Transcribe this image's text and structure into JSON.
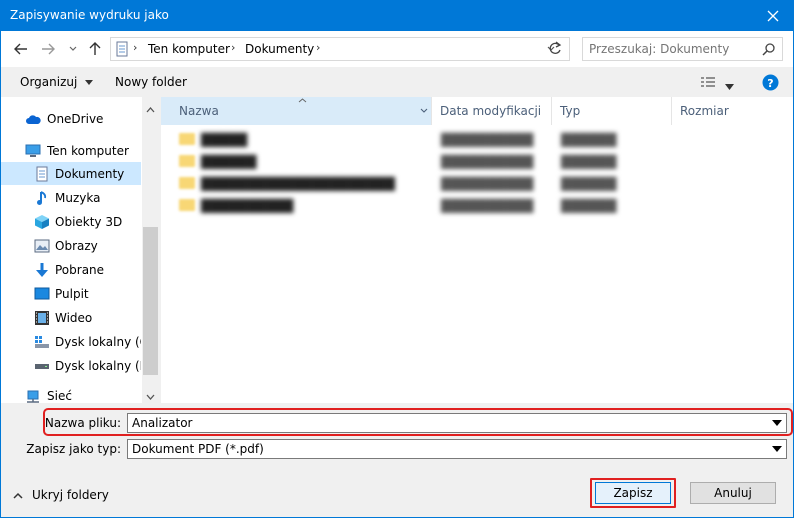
{
  "window": {
    "title": "Zapisywanie wydruku jako"
  },
  "address": {
    "crumbs": [
      "Ten komputer",
      "Dokumenty"
    ]
  },
  "search": {
    "placeholder": "Przeszukaj: Dokumenty"
  },
  "toolbar": {
    "organize_label": "Organizuj",
    "new_folder_label": "Nowy folder"
  },
  "sidebar": {
    "items": [
      {
        "label": "OneDrive",
        "icon": "cloud-icon"
      },
      {
        "label": "Ten komputer",
        "icon": "computer-icon"
      },
      {
        "label": "Dokumenty",
        "icon": "document-icon",
        "selected": true
      },
      {
        "label": "Muzyka",
        "icon": "music-note-icon"
      },
      {
        "label": "Obiekty 3D",
        "icon": "cube-3d-icon"
      },
      {
        "label": "Obrazy",
        "icon": "picture-icon"
      },
      {
        "label": "Pobrane",
        "icon": "download-arrow-icon"
      },
      {
        "label": "Pulpit",
        "icon": "desktop-icon"
      },
      {
        "label": "Wideo",
        "icon": "film-icon"
      },
      {
        "label": "Dysk lokalny (C:)",
        "icon": "drive-c-icon"
      },
      {
        "label": "Dysk lokalny (D:)",
        "icon": "drive-icon"
      },
      {
        "label": "Sieć",
        "icon": "network-icon"
      }
    ]
  },
  "columns": {
    "name": "Nazwa",
    "date": "Data modyfikacji",
    "type": "Typ",
    "size": "Rozmiar"
  },
  "form": {
    "filename_label": "Nazwa pliku:",
    "filename_value": "Analizator",
    "filetype_label": "Zapisz jako typ:",
    "filetype_value": "Dokument PDF (*.pdf)"
  },
  "footer": {
    "hide_folders_label": "Ukryj foldery",
    "save_label": "Zapisz",
    "cancel_label": "Anuluj"
  },
  "colors": {
    "accent": "#0078d7",
    "highlight": "#e02020",
    "selection": "#cce8ff"
  }
}
